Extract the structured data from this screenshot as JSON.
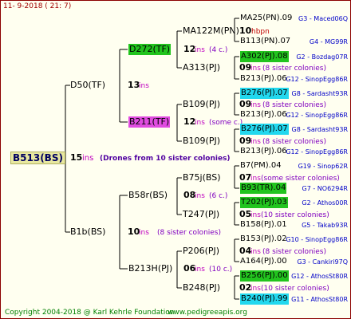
{
  "header": {
    "timestamp": "11-   9-2018 (  21:   7)"
  },
  "footer": {
    "copyright": "Copyright 2004-2018 @ Karl Kehrle Foundation",
    "site": "www.pedigreeapis.org"
  },
  "root": {
    "name": "B513(BS)",
    "num": "15",
    "ins": "ins",
    "note": "(Drones from 10 sister colonies)"
  },
  "gen1": [
    {
      "name": "D50(TF)",
      "num": "13",
      "ins": "ins"
    },
    {
      "name": "B1b(BS)",
      "num": "10",
      "ins": "ins",
      "note": "(8 sister colonies)"
    }
  ],
  "gen2": [
    {
      "name": "D272(TF)",
      "num": "12",
      "ins": "ins",
      "note": "(4 c.)",
      "hl": "#22c41e"
    },
    {
      "name": "B211(TF)",
      "num": "12",
      "ins": "ins",
      "note": "(some c.)",
      "hl": "#e04ce0"
    },
    {
      "name": "B58r(BS)",
      "num": "08",
      "ins": "ins",
      "note": "(6 c.)"
    },
    {
      "name": "B213H(PJ)",
      "num": "06",
      "ins": "ins",
      "note": "(10 c.)"
    }
  ],
  "gen3": [
    {
      "name": "MA122M(PN)",
      "num": "10",
      "ins": "hbpn"
    },
    {
      "name": "A313(PJ)",
      "num": "09",
      "ins": "ins",
      "note": "(8 sister colonies)"
    },
    {
      "name": "B109(PJ)",
      "num": "09",
      "ins": "ins",
      "note": "(8 sister colonies)"
    },
    {
      "name": "B109(PJ)",
      "num": "09",
      "ins": "ins",
      "note": "(8 sister colonies)"
    },
    {
      "name": "B75j(BS)",
      "num": "07",
      "ins": "ins",
      "note": "(some sister colonies)"
    },
    {
      "name": "T247(PJ)",
      "num": "05",
      "ins": "ins",
      "note": "(10 sister colonies)"
    },
    {
      "name": "P206(PJ)",
      "num": "04",
      "ins": "ins",
      "note": "(8 sister colonies)"
    },
    {
      "name": "B248(PJ)",
      "num": "02",
      "ins": "ins",
      "note": "(10 sister colonies)"
    }
  ],
  "gen4": [
    {
      "name": "MA25(PN).09",
      "group": "G3 - Maced06Q"
    },
    {
      "name": "B113(PN).07",
      "group": "G4 - MG99R"
    },
    {
      "name": "A302(PJ).08",
      "group": "G2 - Bozdag07R",
      "hl": "#22c41e"
    },
    {
      "name": "B213(PJ).06",
      "group": "G12 - SinopEgg86R"
    },
    {
      "name": "B276(PJ).07",
      "group": "G8 - Sardasht93R",
      "hl": "#22d8ee"
    },
    {
      "name": "B213(PJ).06",
      "group": "G12 - SinopEgg86R"
    },
    {
      "name": "B276(PJ).07",
      "group": "G8 - Sardasht93R",
      "hl": "#22d8ee"
    },
    {
      "name": "B213(PJ).06",
      "group": "G12 - SinopEgg86R"
    },
    {
      "name": "B7(PM).04",
      "group": "G19 - Sinop62R"
    },
    {
      "name": "B93(TR).04",
      "group": "G7 - NO6294R",
      "hl": "#22c41e"
    },
    {
      "name": "T202(PJ).03",
      "group": "G2 - Athos00R",
      "hl": "#22c41e"
    },
    {
      "name": "B158(PJ).01",
      "group": "G5 - Takab93R"
    },
    {
      "name": "B153(PJ).02",
      "group": "G10 - SinopEgg86R"
    },
    {
      "name": "A164(PJ).00",
      "group": "G3 - Cankiri97Q"
    },
    {
      "name": "B256(PJ).00",
      "group": "G12 - AthosSt80R",
      "hl": "#22c41e"
    },
    {
      "name": "B240(PJ).99",
      "group": "G11 - AthosSt80R",
      "hl": "#22d8ee"
    }
  ]
}
